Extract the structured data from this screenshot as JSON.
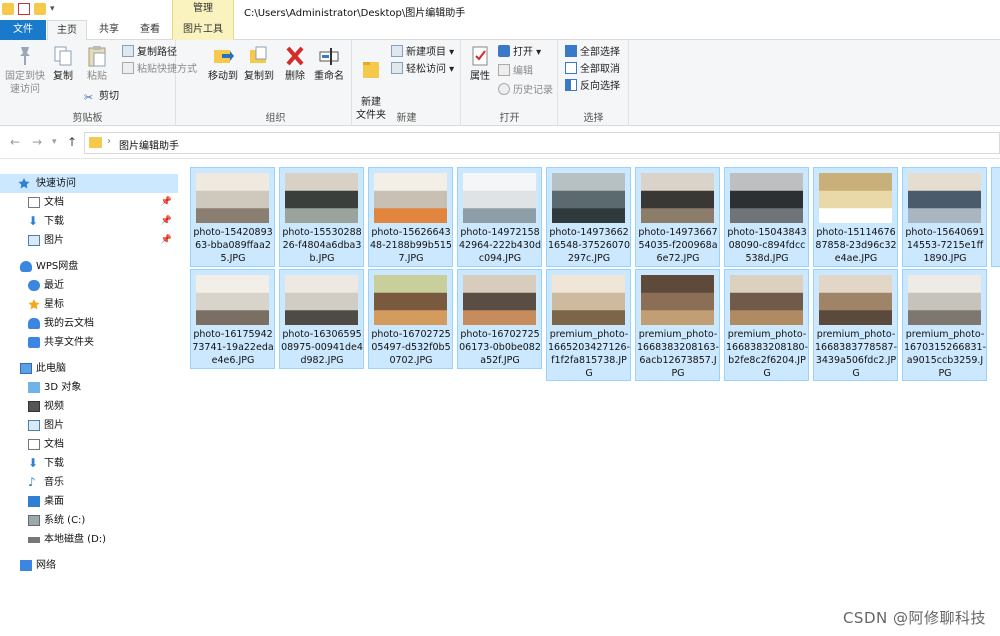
{
  "title_bar": {
    "manage_tab": "管理",
    "path": "C:\\Users\\Administrator\\Desktop\\图片编辑助手"
  },
  "tabs": {
    "file": "文件",
    "home": "主页",
    "share": "共享",
    "view": "查看",
    "picture_tools": "图片工具"
  },
  "ribbon": {
    "clipboard": {
      "label": "剪贴板",
      "pin_quick": "固定到快\n速访问",
      "copy": "复制",
      "paste": "粘贴",
      "copy_path": "复制路径",
      "paste_shortcut": "粘贴快捷方式",
      "cut": "剪切"
    },
    "organize": {
      "label": "组织",
      "move_to": "移动到",
      "copy_to": "复制到",
      "delete": "删除",
      "rename": "重命名"
    },
    "new": {
      "label": "新建",
      "new_folder": "新建\n文件夹",
      "new_item": "新建项目",
      "easy_access": "轻松访问"
    },
    "open": {
      "label": "打开",
      "properties": "属性",
      "open": "打开",
      "edit": "编辑",
      "history": "历史记录"
    },
    "select": {
      "label": "选择",
      "select_all": "全部选择",
      "select_none": "全部取消",
      "invert": "反向选择"
    }
  },
  "address_bar": {
    "crumb": "图片编辑助手"
  },
  "sidebar": {
    "quick_access": "快速访问",
    "qa_items": [
      "文档",
      "下载",
      "图片"
    ],
    "wps": "WPS网盘",
    "wps_items": [
      "最近",
      "星标",
      "我的云文档",
      "共享文件夹"
    ],
    "this_pc": "此电脑",
    "pc_items": [
      "3D 对象",
      "视频",
      "图片",
      "文档",
      "下载",
      "音乐",
      "桌面",
      "系统 (C:)",
      "本地磁盘 (D:)"
    ],
    "network": "网络"
  },
  "files": [
    "photo-1542089363-bba089ffaa25.JPG",
    "photo-1553028826-f4804a6dba3b.JPG",
    "photo-1562664348-2188b99b5157.JPG",
    "photo-1497215842964-222b430dc094.JPG",
    "photo-1497366216548-37526070297c.JPG",
    "photo-1497366754035-f200968a6e72.JPG",
    "photo-1504384308090-c894fdcc538d.JPG",
    "photo-1511467687858-23d96c32e4ae.JPG",
    "photo-1564069114553-7215e1ff1890.JPG",
    "photo-1617594273741-19a22edae4e6.JPG",
    "photo-1630659508975-00941de4d982.JPG",
    "photo-1670272505497-d532f0b50702.JPG",
    "photo-1670272506173-0b0be082a52f.JPG",
    "premium_photo-1665203427126-f1f2fa815738.JPG",
    "premium_photo-1668383208163-6acb12673857.JPG",
    "premium_photo-1668383208180-b2fe8c2f6204.JPG",
    "premium_photo-1668383778587-3439a506fdc2.JPG",
    "premium_photo-1670315266831-a9015ccb3259.JPG"
  ],
  "watermark": "CSDN @阿修聊科技"
}
